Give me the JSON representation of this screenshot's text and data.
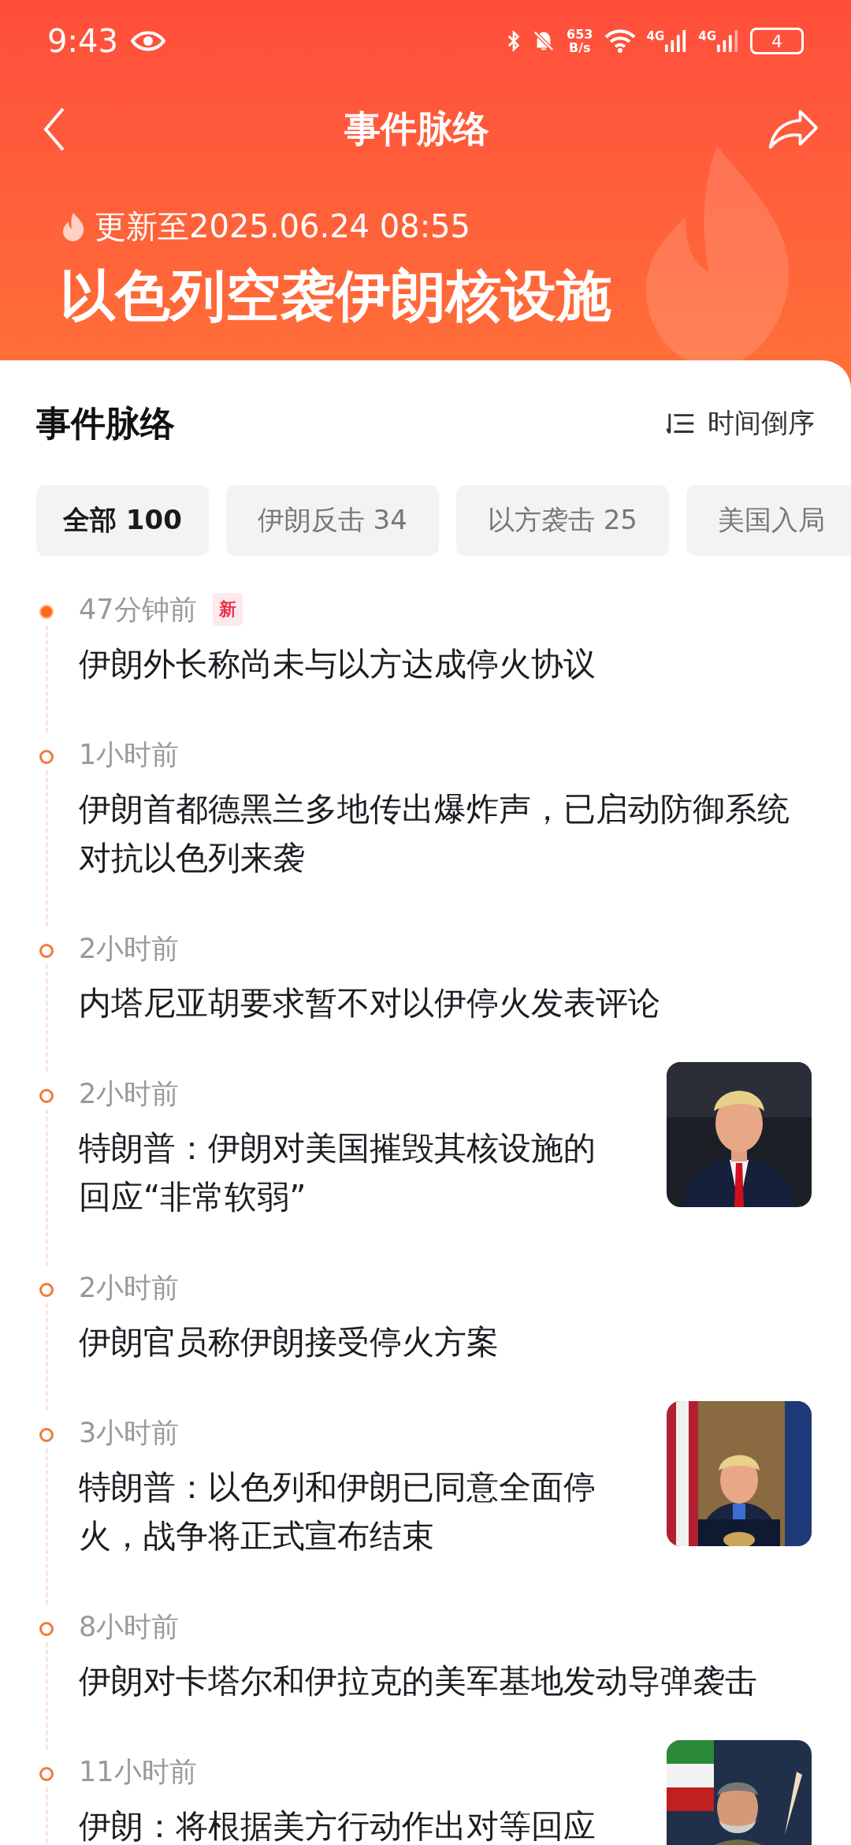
{
  "status_bar": {
    "time": "9:43",
    "net_speed": "653",
    "net_unit": "B/s",
    "signals": [
      "4G",
      "4G"
    ],
    "battery": "4"
  },
  "nav": {
    "title": "事件脉络"
  },
  "hero": {
    "updated": "更新至2025.06.24 08:55",
    "title": "以色列空袭伊朗核设施"
  },
  "section": {
    "title": "事件脉络",
    "sort": "时间倒序"
  },
  "filters": [
    {
      "label": "全部 100",
      "selected": true
    },
    {
      "label": "伊朗反击 34",
      "selected": false
    },
    {
      "label": "以方袭击 25",
      "selected": false
    },
    {
      "label": "美国入局",
      "selected": false
    }
  ],
  "events": [
    {
      "time": "47分钟前",
      "badge": "新",
      "highlighted": true,
      "title": "伊朗外长称尚未与以方达成停火协议",
      "picture": false
    },
    {
      "time": "1小时前",
      "highlighted": false,
      "title": "伊朗首都德黑兰多地传出爆炸声，已启动防御系统对抗以色列来袭",
      "picture": false
    },
    {
      "time": "2小时前",
      "highlighted": false,
      "title": "内塔尼亚胡要求暂不对以伊停火发表评论",
      "picture": false
    },
    {
      "time": "2小时前",
      "highlighted": false,
      "title": "特朗普：伊朗对美国摧毁其核设施的回应“非常软弱”",
      "picture": true
    },
    {
      "time": "2小时前",
      "highlighted": false,
      "title": "伊朗官员称伊朗接受停火方案",
      "picture": false
    },
    {
      "time": "3小时前",
      "highlighted": false,
      "title": "特朗普：以色列和伊朗已同意全面停火，战争将正式宣布结束",
      "picture": true
    },
    {
      "time": "8小时前",
      "highlighted": false,
      "title": "伊朗对卡塔尔和伊拉克的美军基地发动导弹袭击",
      "picture": false
    },
    {
      "time": "11小时前",
      "highlighted": false,
      "title": "伊朗：将根据美方行动作出对等回应",
      "picture": true
    }
  ]
}
